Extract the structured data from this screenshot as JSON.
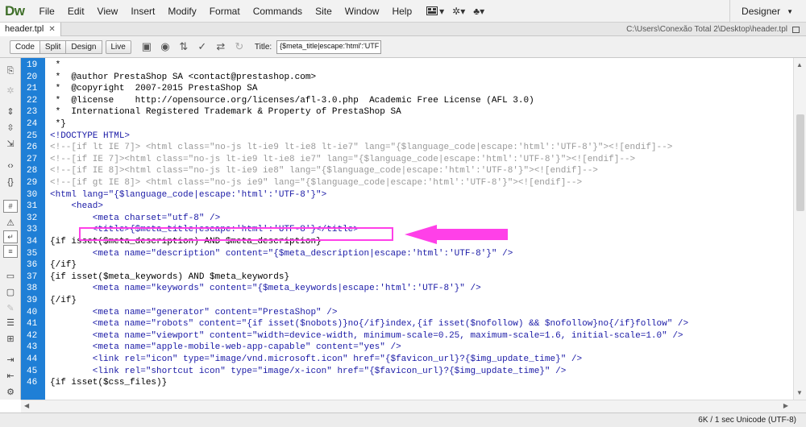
{
  "app": {
    "logo": "Dw"
  },
  "menu": [
    "File",
    "Edit",
    "View",
    "Insert",
    "Modify",
    "Format",
    "Commands",
    "Site",
    "Window",
    "Help"
  ],
  "workspace": {
    "label": "Designer"
  },
  "tab": {
    "name": "header.tpl",
    "path": "C:\\Users\\Conexão Total 2\\Desktop\\header.tpl"
  },
  "views": {
    "code": "Code",
    "split": "Split",
    "design": "Design",
    "live": "Live"
  },
  "title_field": {
    "label": "Title:",
    "value": "{$meta_title|escape:'html':'UTF"
  },
  "colors": {
    "gutter": "#1f7fd6",
    "annotation": "#ff40e8",
    "tag": "#1a1aa6",
    "comment": "#999999"
  },
  "icons": [
    "multiscreen-icon",
    "preview-icon",
    "debug-icon",
    "validate-icon",
    "file-management-icon",
    "refresh-icon"
  ],
  "code_lines": [
    {
      "num": "19",
      "text": " *",
      "type": "default"
    },
    {
      "num": "20",
      "text": " *  @author PrestaShop SA <contact@prestashop.com>",
      "type": "default"
    },
    {
      "num": "21",
      "text": " *  @copyright  2007-2015 PrestaShop SA",
      "type": "default"
    },
    {
      "num": "22",
      "text": " *  @license    http://opensource.org/licenses/afl-3.0.php  Academic Free License (AFL 3.0)",
      "type": "default"
    },
    {
      "num": "23",
      "text": " *  International Registered Trademark & Property of PrestaShop SA",
      "type": "default"
    },
    {
      "num": "24",
      "text": " *}",
      "type": "default"
    },
    {
      "num": "25",
      "text": "<!DOCTYPE HTML>",
      "type": "doctype"
    },
    {
      "num": "26",
      "text": "<!--[if lt IE 7]> <html class=\"no-js lt-ie9 lt-ie8 lt-ie7\" lang=\"{$language_code|escape:'html':'UTF-8'}\"><![endif]-->",
      "type": "comment"
    },
    {
      "num": "27",
      "text": "<!--[if IE 7]><html class=\"no-js lt-ie9 lt-ie8 ie7\" lang=\"{$language_code|escape:'html':'UTF-8'}\"><![endif]-->",
      "type": "comment"
    },
    {
      "num": "28",
      "text": "<!--[if IE 8]><html class=\"no-js lt-ie9 ie8\" lang=\"{$language_code|escape:'html':'UTF-8'}\"><![endif]-->",
      "type": "comment"
    },
    {
      "num": "29",
      "text": "<!--[if gt IE 8]> <html class=\"no-js ie9\" lang=\"{$language_code|escape:'html':'UTF-8'}\"><![endif]-->",
      "type": "comment"
    },
    {
      "num": "30",
      "text": "<html lang=\"{$language_code|escape:'html':'UTF-8'}\">",
      "type": "tag"
    },
    {
      "num": "31",
      "text": "    <head>",
      "type": "tag"
    },
    {
      "num": "32",
      "text": "        <meta charset=\"utf-8\" />",
      "type": "tag"
    },
    {
      "num": "33",
      "text": "        <title>{$meta_title|escape:'html':'UTF-8'}</title>",
      "type": "tag"
    },
    {
      "num": "34",
      "text": "{if isset($meta_description) AND $meta_description}",
      "type": "default"
    },
    {
      "num": "35",
      "text": "        <meta name=\"description\" content=\"{$meta_description|escape:'html':'UTF-8'}\" />",
      "type": "tag"
    },
    {
      "num": "36",
      "text": "{/if}",
      "type": "default"
    },
    {
      "num": "37",
      "text": "{if isset($meta_keywords) AND $meta_keywords}",
      "type": "default"
    },
    {
      "num": "38",
      "text": "        <meta name=\"keywords\" content=\"{$meta_keywords|escape:'html':'UTF-8'}\" />",
      "type": "tag"
    },
    {
      "num": "39",
      "text": "{/if}",
      "type": "default"
    },
    {
      "num": "40",
      "text": "        <meta name=\"generator\" content=\"PrestaShop\" />",
      "type": "tag"
    },
    {
      "num": "41",
      "text": "        <meta name=\"robots\" content=\"{if isset($nobots)}no{/if}index,{if isset($nofollow) && $nofollow}no{/if}follow\" />",
      "type": "tag"
    },
    {
      "num": "42",
      "text": "        <meta name=\"viewport\" content=\"width=device-width, minimum-scale=0.25, maximum-scale=1.6, initial-scale=1.0\" />",
      "type": "tag"
    },
    {
      "num": "43",
      "text": "        <meta name=\"apple-mobile-web-app-capable\" content=\"yes\" />",
      "type": "tag"
    },
    {
      "num": "44",
      "text": "        <link rel=\"icon\" type=\"image/vnd.microsoft.icon\" href=\"{$favicon_url}?{$img_update_time}\" />",
      "type": "tag"
    },
    {
      "num": "45",
      "text": "        <link rel=\"shortcut icon\" type=\"image/x-icon\" href=\"{$favicon_url}?{$img_update_time}\" />",
      "type": "tag"
    },
    {
      "num": "46",
      "text": "{if isset($css_files)}",
      "type": "default"
    }
  ],
  "status": {
    "text": "6K / 1 sec  Unicode (UTF-8)"
  }
}
